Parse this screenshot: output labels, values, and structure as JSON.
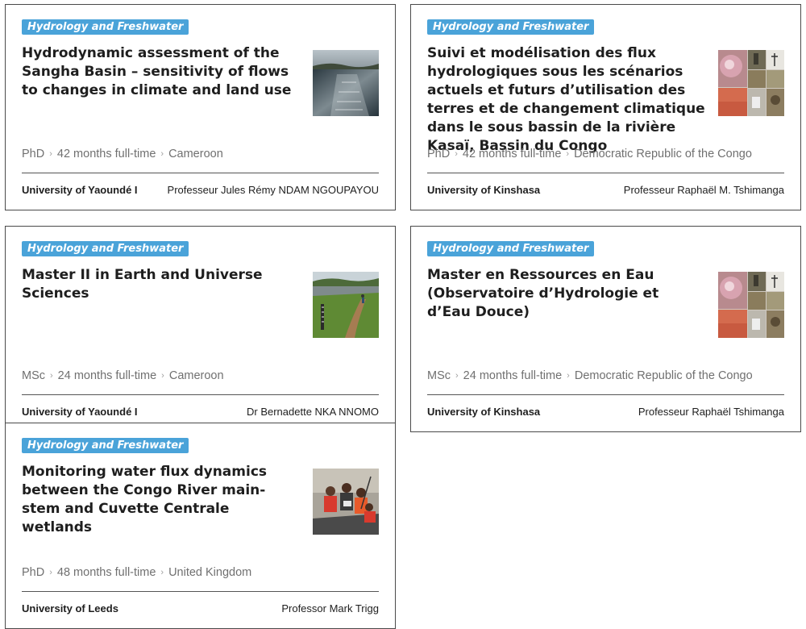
{
  "cards": [
    {
      "tag": "Hydrology and Freshwater",
      "title": "Hydrodynamic assessment of the Sangha Basin – sensitivity of flows to changes in climate and land use",
      "image": "river-photo",
      "level": "PhD",
      "duration": "42 months full-time",
      "country": "Cameroon",
      "university": "University of Yaoundé I",
      "supervisor": "Professeur Jules Rémy NDAM NGOUPAYOU"
    },
    {
      "tag": "Hydrology and Freshwater",
      "title": "Suivi et modélisation des flux hydrologiques sous les scénarios actuels et futurs d’utilisation des terres et de changement climatique dans le sous bassin de la rivière Kasaï, Bassin du Congo",
      "image": "collage-photo",
      "level": "PhD",
      "duration": "42 months full-time",
      "country": "Democratic Republic of the Congo",
      "university": "University of Kinshasa",
      "supervisor": "Professeur Raphaël M. Tshimanga"
    },
    {
      "tag": "Hydrology and Freshwater",
      "title": "Master II in Earth and Universe Sciences",
      "image": "riverbank-gauge-photo",
      "level": "MSc",
      "duration": "24 months full-time",
      "country": "Cameroon",
      "university": "University of Yaoundé I",
      "supervisor": "Dr Bernadette NKA NNOMO"
    },
    {
      "tag": "Hydrology and Freshwater",
      "title": "Master en Ressources en Eau (Observatoire d’Hydrologie et d’Eau Douce)",
      "image": "collage-photo",
      "level": "MSc",
      "duration": "24 months full-time",
      "country": "Democratic Republic of the Congo",
      "university": "University of Kinshasa",
      "supervisor": "Professeur Raphaël Tshimanga"
    },
    {
      "tag": "Hydrology and Freshwater",
      "title": "Monitoring water flux dynamics between the Congo River main-stem and Cuvette Centrale wetlands",
      "image": "boat-crew-photo",
      "level": "PhD",
      "duration": "48 months full-time",
      "country": "United Kingdom",
      "university": "University of Leeds",
      "supervisor": "Professor Mark Trigg"
    }
  ]
}
